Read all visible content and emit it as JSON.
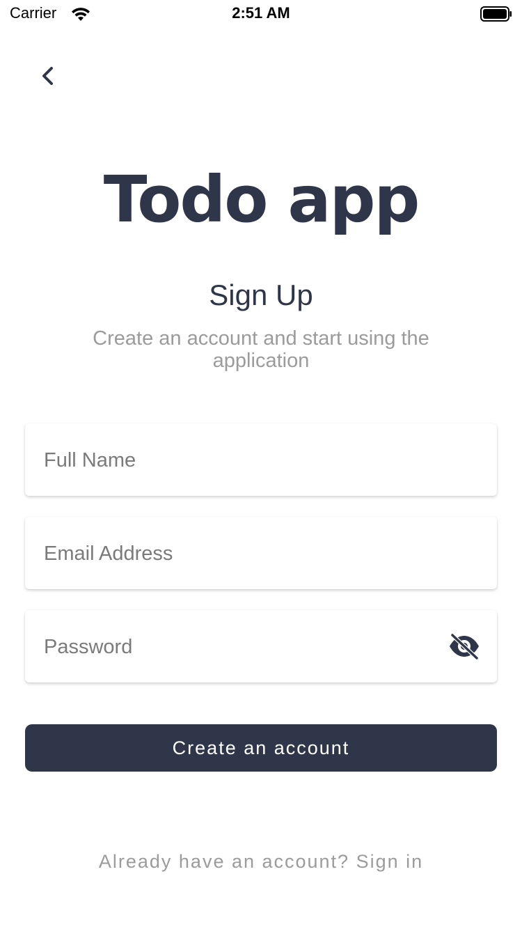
{
  "status_bar": {
    "carrier": "Carrier",
    "time": "2:51 AM"
  },
  "icons": {
    "back": "chevron-left-icon",
    "wifi": "wifi-icon",
    "battery": "battery-icon",
    "password_toggle": "eye-off-icon"
  },
  "logo": {
    "text": "Todo app"
  },
  "header": {
    "title": "Sign Up",
    "subtitle": "Create an account and start using the application"
  },
  "form": {
    "full_name_placeholder": "Full Name",
    "email_placeholder": "Email Address",
    "password_placeholder": "Password",
    "submit_label": "Create an account"
  },
  "footer": {
    "signin_text": "Already have an account? Sign in"
  },
  "colors": {
    "primary": "#2f3649",
    "muted_text": "#9b9b9b",
    "background": "#ffffff"
  }
}
